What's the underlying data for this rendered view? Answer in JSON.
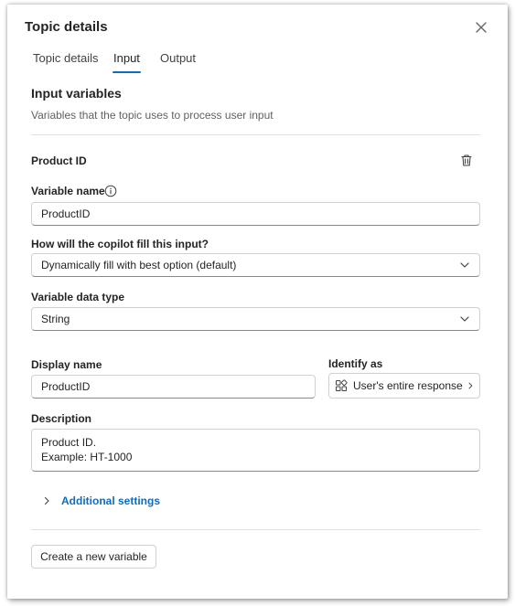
{
  "dialog": {
    "title": "Topic details",
    "close_icon": "close-icon"
  },
  "tabs": [
    {
      "label": "Topic details",
      "active": false
    },
    {
      "label": "Input",
      "active": true
    },
    {
      "label": "Output",
      "active": false
    }
  ],
  "section": {
    "title": "Input variables",
    "description": "Variables that the topic uses to process user input"
  },
  "variable": {
    "header": "Product ID",
    "delete_icon": "trash-icon",
    "name_label": "Variable name",
    "name_value": "ProductID",
    "fill_label": "How will the copilot fill this input?",
    "fill_value": "Dynamically fill with best option (default)",
    "type_label": "Variable data type",
    "type_value": "String",
    "display_label": "Display name",
    "display_value": "ProductID",
    "identify_label": "Identify as",
    "identify_value": "User's entire response",
    "description_label": "Description",
    "description_value": "Product ID.\nExample: HT-1000"
  },
  "additional_settings": "Additional settings",
  "create_button": "Create a new variable",
  "colors": {
    "accent": "#0f6cbd",
    "text": "#242424",
    "muted": "#616161"
  }
}
